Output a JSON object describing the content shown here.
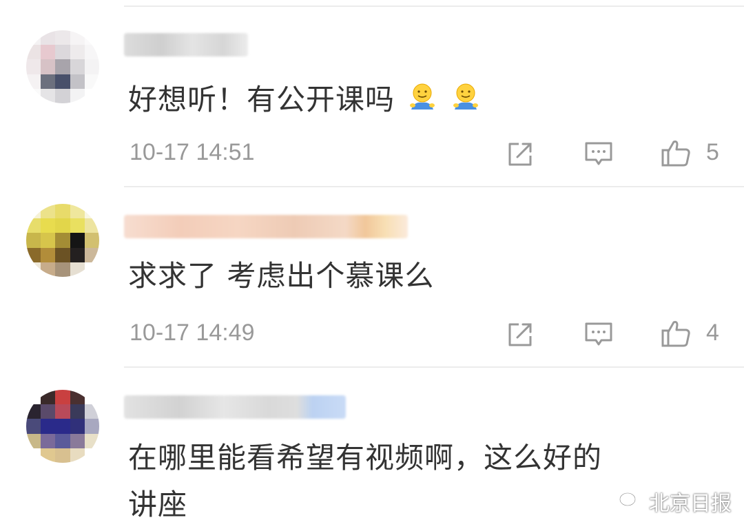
{
  "comments": [
    {
      "text": "好想听！有公开课吗",
      "time": "10-17 14:51",
      "like_count": "5",
      "emoji": [
        "smiley-face-emoji",
        "smiley-face-emoji"
      ]
    },
    {
      "text": "求求了 考虑出个慕课么",
      "time": "10-17 14:49",
      "like_count": "4"
    },
    {
      "text_line1": "在哪里能看希望有视频啊，这么好的",
      "text_line2": "讲座"
    }
  ],
  "watermark": {
    "label": "北京日报",
    "icon": "wechat-icon"
  },
  "colors": {
    "meta": "#999999",
    "text": "#333333",
    "divider": "#ececec"
  }
}
